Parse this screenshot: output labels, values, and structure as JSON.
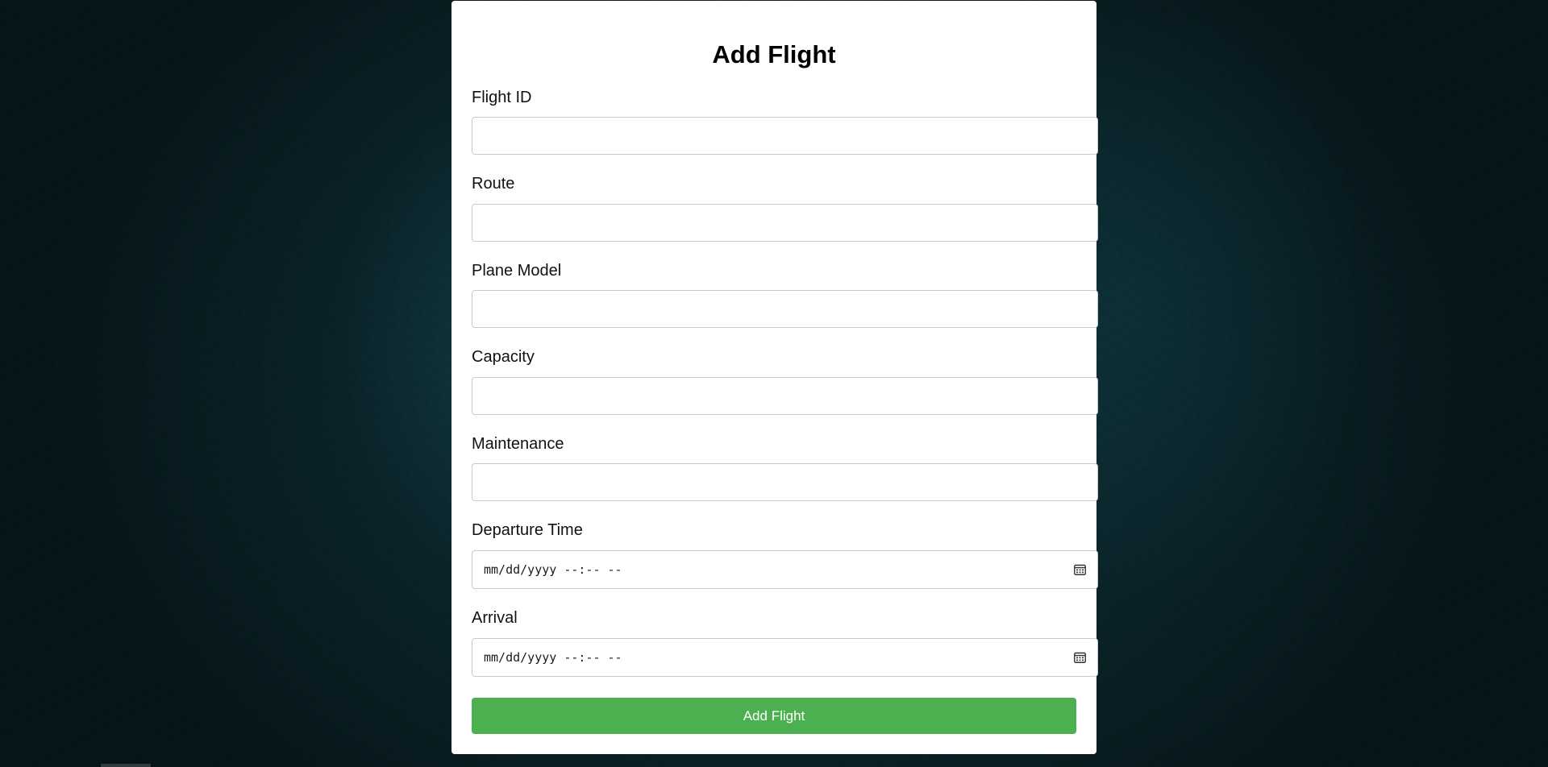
{
  "page": {
    "title": "Add Flight"
  },
  "form": {
    "fields": [
      {
        "label": "Flight ID",
        "value": "",
        "type": "text"
      },
      {
        "label": "Route",
        "value": "",
        "type": "text"
      },
      {
        "label": "Plane Model",
        "value": "",
        "type": "text"
      },
      {
        "label": "Capacity",
        "value": "",
        "type": "text"
      },
      {
        "label": "Maintenance",
        "value": "",
        "type": "text"
      },
      {
        "label": "Departure Time",
        "value": "mm/dd/yyyy --:-- --",
        "type": "datetime-local",
        "icon": "calendar-icon"
      },
      {
        "label": "Arrival",
        "value": "mm/dd/yyyy --:-- --",
        "type": "datetime-local",
        "icon": "calendar-icon"
      }
    ],
    "submit_label": "Add Flight"
  },
  "colors": {
    "accent": "#4caf50",
    "card": "#ffffff",
    "background": "#0b272d"
  }
}
